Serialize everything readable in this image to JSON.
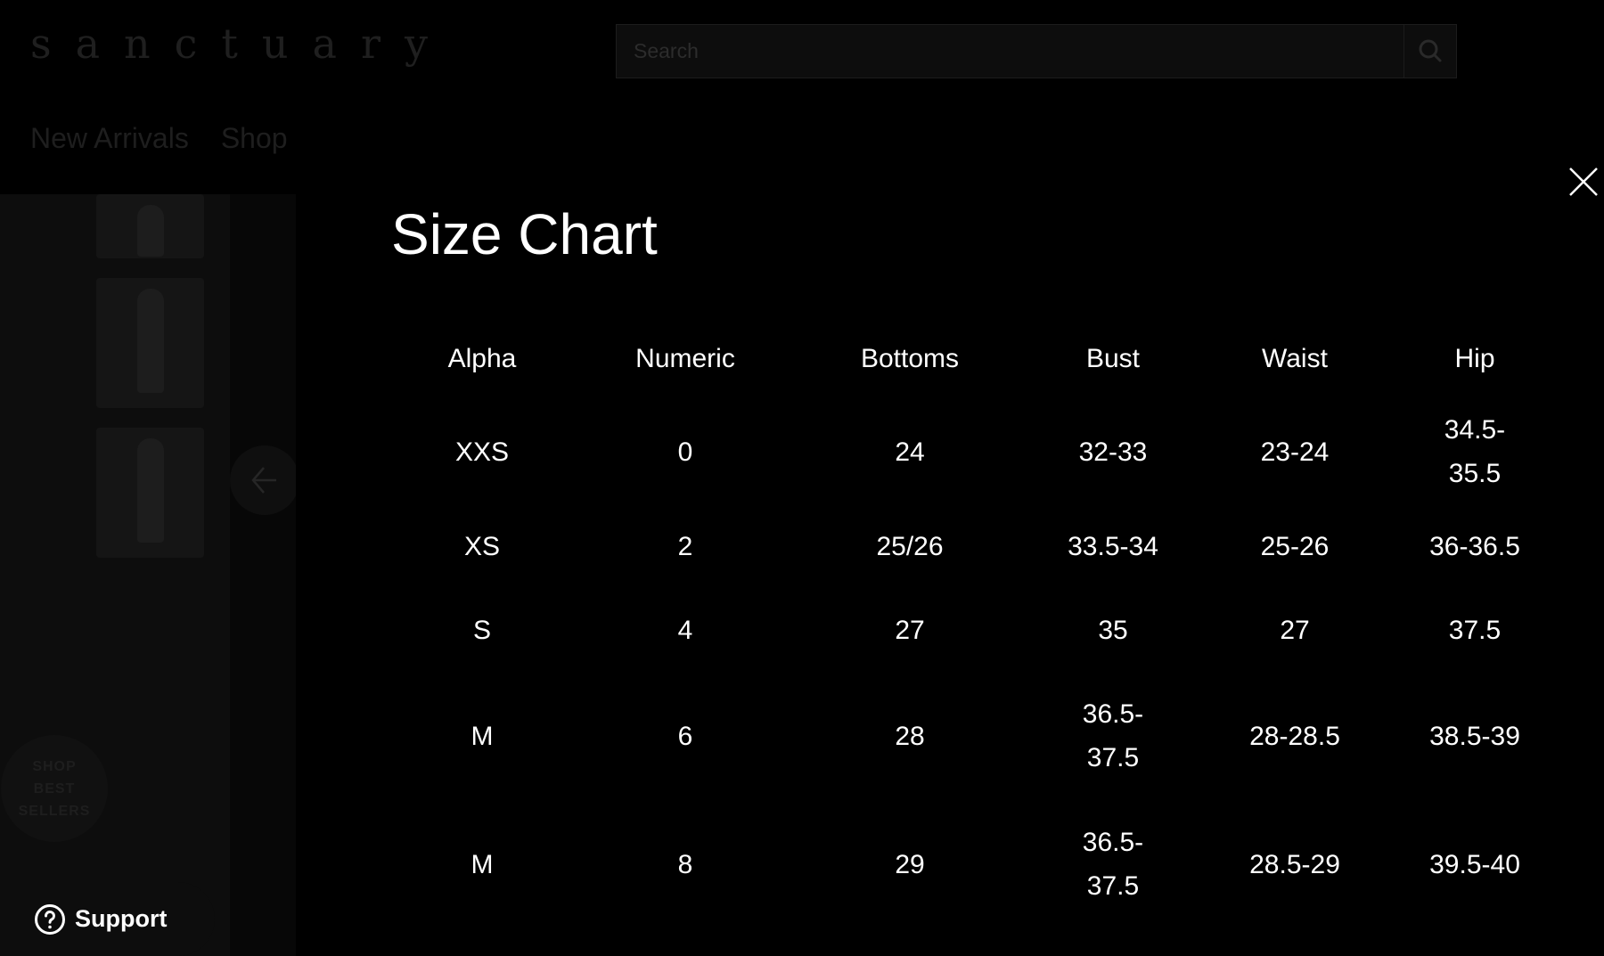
{
  "header": {
    "logo": "sanctuary",
    "search_placeholder": "Search",
    "nav": [
      "New Arrivals",
      "Shop"
    ]
  },
  "floating": {
    "best_sellers_badge": "SHOP BEST SELLERS",
    "support_label": "Support"
  },
  "modal": {
    "title": "Size Chart",
    "columns": [
      "Alpha",
      "Numeric",
      "Bottoms",
      "Bust",
      "Waist",
      "Hip"
    ],
    "rows": [
      [
        "XXS",
        "0",
        "24",
        "32-33",
        "23-24",
        "34.5-35.5"
      ],
      [
        "XS",
        "2",
        "25/26",
        "33.5-34",
        "25-26",
        "36-36.5"
      ],
      [
        "S",
        "4",
        "27",
        "35",
        "27",
        "37.5"
      ],
      [
        "M",
        "6",
        "28",
        "36.5-37.5",
        "28-28.5",
        "38.5-39"
      ],
      [
        "M",
        "8",
        "29",
        "36.5-37.5",
        "28.5-29",
        "39.5-40"
      ]
    ]
  },
  "icons": {
    "search": "search-icon",
    "close": "close-icon",
    "arrow_left": "arrow-left-icon",
    "support": "help-circle-icon"
  },
  "colors": {
    "background": "#000000",
    "text": "#ffffff",
    "dimmed_panel": "#0d0d0d"
  }
}
